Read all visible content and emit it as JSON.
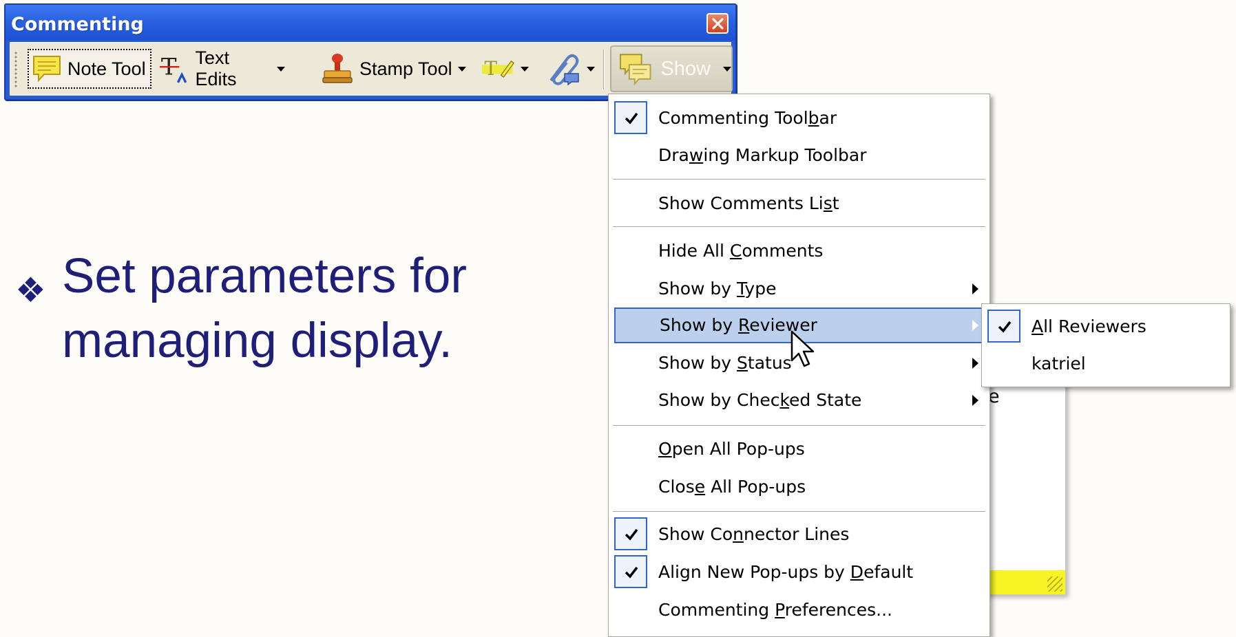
{
  "toolbar": {
    "title": "Commenting",
    "buttons": {
      "note_tool": "Note Tool",
      "text_edits": "Text Edits",
      "stamp_tool": "Stamp Tool",
      "show": "Show"
    },
    "icons": [
      "note-icon",
      "text-edits-icon",
      "stamp-icon",
      "highlight-icon",
      "attach-icon",
      "show-comments-icon"
    ]
  },
  "bullet": {
    "glyph": "❖",
    "line1": "Set parameters for",
    "line2": "managing display."
  },
  "popup_note": {
    "fragment": "e"
  },
  "menu": {
    "items": [
      {
        "pre": "Commenting Tool",
        "u": "b",
        "post": "ar",
        "checked": true
      },
      {
        "pre": "Dra",
        "u": "w",
        "post": "ing Markup Toolbar",
        "checked": false
      },
      {
        "pre": "Show Comments Li",
        "u": "s",
        "post": "t",
        "checked": false
      },
      {
        "pre": "Hide All ",
        "u": "C",
        "post": "omments",
        "checked": false
      },
      {
        "pre": "Show by ",
        "u": "T",
        "post": "ype",
        "checked": false,
        "submenu": true
      },
      {
        "pre": "Show by ",
        "u": "R",
        "post": "eviewer",
        "checked": false,
        "submenu": true,
        "highlighted": true
      },
      {
        "pre": "Show by ",
        "u": "S",
        "post": "tatus",
        "checked": false,
        "submenu": true
      },
      {
        "pre": "Show by Chec",
        "u": "k",
        "post": "ed State",
        "checked": false,
        "submenu": true
      },
      {
        "pre": "",
        "u": "O",
        "post": "pen All Pop-ups",
        "checked": false
      },
      {
        "pre": "Clos",
        "u": "e",
        "post": " All Pop-ups",
        "checked": false
      },
      {
        "pre": "Show Co",
        "u": "n",
        "post": "nector Lines",
        "checked": true
      },
      {
        "pre": "Align New Pop-ups by ",
        "u": "D",
        "post": "efault",
        "checked": true
      },
      {
        "pre": "Commenting ",
        "u": "P",
        "post": "references...",
        "checked": false
      }
    ]
  },
  "submenu": {
    "items": [
      {
        "pre": "",
        "u": "A",
        "post": "ll Reviewers",
        "checked": true
      },
      {
        "pre": "katriel",
        "u": "",
        "post": "",
        "checked": false
      }
    ]
  },
  "colors": {
    "titlebar": "#2a61e0",
    "highlight": "#bcd0ee",
    "highlight_border": "#3165c7",
    "bullet_text": "#1f1f7a",
    "popup_yellow": "#f7f324"
  }
}
